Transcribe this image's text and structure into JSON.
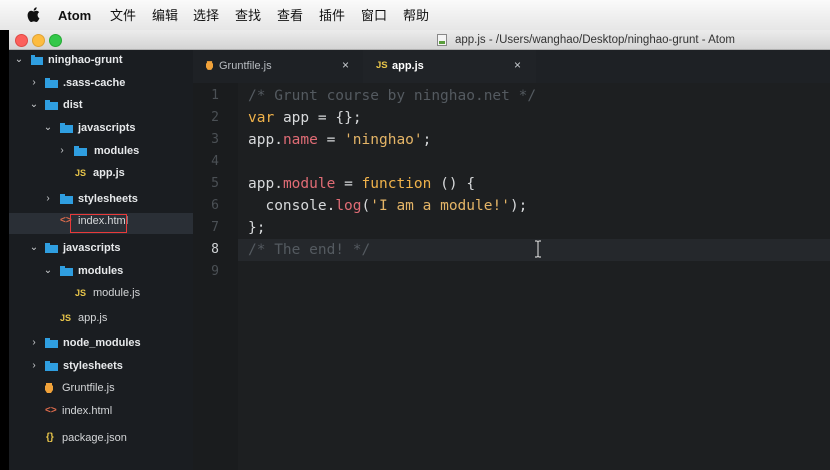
{
  "menubar": {
    "app": "Atom",
    "items": [
      "文件",
      "编辑",
      "选择",
      "查找",
      "查看",
      "插件",
      "窗口",
      "帮助"
    ]
  },
  "window": {
    "title": "app.js - /Users/wanghao/Desktop/ninghao-grunt - Atom"
  },
  "tree": {
    "root": "ninghao-grunt",
    "items": [
      {
        "label": ".sass-cache"
      },
      {
        "label": "dist"
      },
      {
        "label": "javascripts"
      },
      {
        "label": "modules"
      },
      {
        "label": "app.js",
        "icon": "JS"
      },
      {
        "label": "stylesheets"
      },
      {
        "label": "index.html",
        "icon": "<>"
      },
      {
        "label": "javascripts"
      },
      {
        "label": "modules"
      },
      {
        "label": "module.js",
        "icon": "JS"
      },
      {
        "label": "app.js",
        "icon": "JS"
      },
      {
        "label": "node_modules"
      },
      {
        "label": "stylesheets"
      },
      {
        "label": "Gruntfile.js"
      },
      {
        "label": "index.html",
        "icon": "<>"
      },
      {
        "label": "package.json",
        "icon": "{}"
      }
    ]
  },
  "tabs": [
    {
      "label": "Gruntfile.js",
      "close": "×"
    },
    {
      "label": "app.js",
      "icon": "JS",
      "close": "×"
    }
  ],
  "editor": {
    "line_numbers": [
      "1",
      "2",
      "3",
      "4",
      "5",
      "6",
      "7",
      "8",
      "9"
    ],
    "current_line": 8,
    "lines": [
      "/* Grunt course by ninghao.net */",
      "var app = {};",
      "app.name = 'ninghao';",
      "",
      "app.module = function () {",
      "  console.log('I am a module!');",
      "};",
      "/* The end! */",
      ""
    ]
  },
  "colors": {
    "comment": "#545a60",
    "keyword": "#f0b24a",
    "property": "#e06c75",
    "string": "#e5b567",
    "selection_border": "#e83a3a"
  }
}
